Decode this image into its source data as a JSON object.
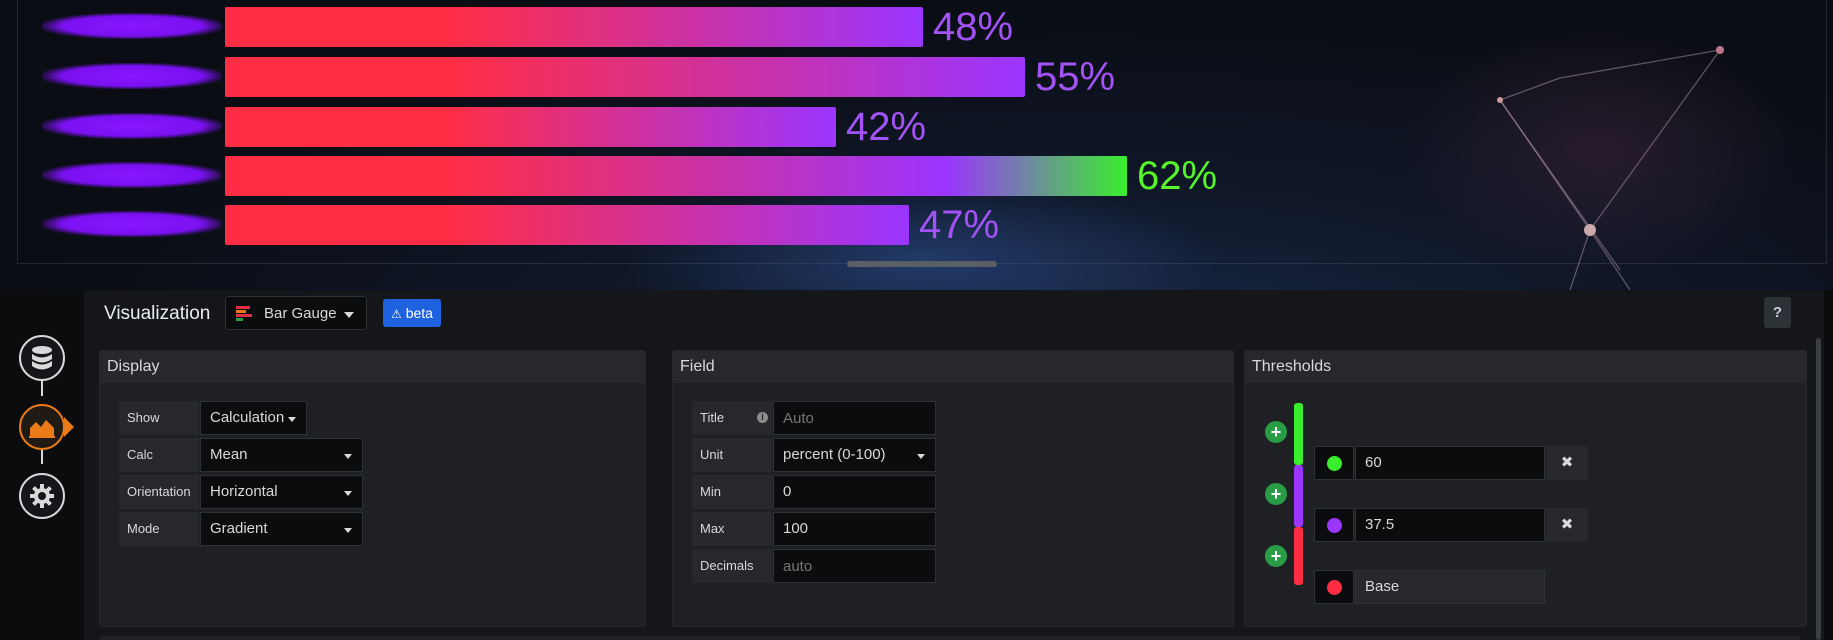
{
  "gauge": {
    "bars": [
      {
        "value": 48,
        "label": "48%",
        "color": "#a352f5"
      },
      {
        "value": 55,
        "label": "55%",
        "color": "#a352f5"
      },
      {
        "value": 42,
        "label": "42%",
        "color": "#a352f5"
      },
      {
        "value": 62,
        "label": "62%",
        "color": "#56f52a"
      },
      {
        "value": 47,
        "label": "47%",
        "color": "#a352f5"
      }
    ],
    "colors": {
      "base": "#ff2d43",
      "mid": "#9b35ff",
      "high": "#3aee2e"
    }
  },
  "visualization": {
    "title": "Visualization",
    "picker_label": "Bar Gauge",
    "beta_label": "beta",
    "help_label": "?"
  },
  "display": {
    "title": "Display",
    "rows": [
      {
        "label": "Show",
        "value": "Calculation"
      },
      {
        "label": "Calc",
        "value": "Mean"
      },
      {
        "label": "Orientation",
        "value": "Horizontal"
      },
      {
        "label": "Mode",
        "value": "Gradient"
      }
    ]
  },
  "field": {
    "title": "Field",
    "rows": [
      {
        "label": "Title",
        "value": "",
        "placeholder": "Auto"
      },
      {
        "label": "Unit",
        "value": "percent (0-100)"
      },
      {
        "label": "Min",
        "value": "0"
      },
      {
        "label": "Max",
        "value": "100"
      },
      {
        "label": "Decimals",
        "value": "",
        "placeholder": "auto"
      }
    ]
  },
  "thresholds": {
    "title": "Thresholds",
    "items": [
      {
        "value": "60",
        "color": "#3aee2e"
      },
      {
        "value": "37.5",
        "color": "#9b35ff"
      },
      {
        "value": "Base",
        "color": "#ff2d43"
      }
    ]
  },
  "rail": {
    "icons": [
      "database-icon",
      "visualization-icon",
      "settings-icon"
    ]
  }
}
